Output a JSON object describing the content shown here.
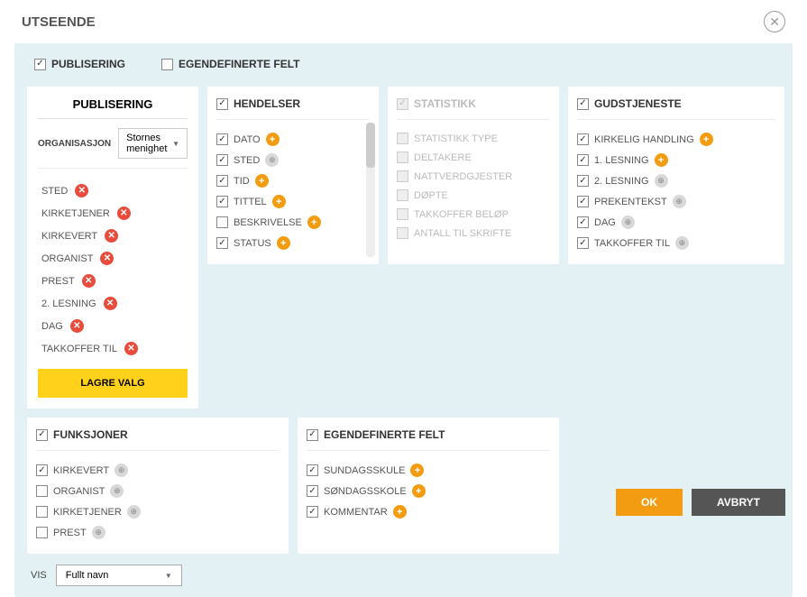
{
  "title": "UTSEENDE",
  "top": {
    "publisering": "PUBLISERING",
    "egendef": "EGENDEFINERTE FELT"
  },
  "hendelser": {
    "title": "HENDELSER",
    "items": [
      {
        "label": "DATO",
        "checked": true,
        "icon": "plus"
      },
      {
        "label": "STED",
        "checked": true,
        "icon": "globe"
      },
      {
        "label": "TID",
        "checked": true,
        "icon": "plus"
      },
      {
        "label": "TITTEL",
        "checked": true,
        "icon": "plus"
      },
      {
        "label": "BESKRIVELSE",
        "checked": false,
        "icon": "plus"
      },
      {
        "label": "STATUS",
        "checked": true,
        "icon": "plus"
      }
    ]
  },
  "statistikk": {
    "title": "STATISTIKK",
    "items": [
      {
        "label": "STATISTIKK TYPE"
      },
      {
        "label": "DELTAKERE"
      },
      {
        "label": "NATTVERDGJESTER"
      },
      {
        "label": "DØPTE"
      },
      {
        "label": "TAKKOFFER BELØP"
      },
      {
        "label": "ANTALL TIL SKRIFTE"
      }
    ]
  },
  "gudstjeneste": {
    "title": "GUDSTJENESTE",
    "items": [
      {
        "label": "KIRKELIG HANDLING",
        "checked": true,
        "icon": "plus"
      },
      {
        "label": "1. LESNING",
        "checked": true,
        "icon": "plus"
      },
      {
        "label": "2. LESNING",
        "checked": true,
        "icon": "globe"
      },
      {
        "label": "PREKENTEKST",
        "checked": true,
        "icon": "globe"
      },
      {
        "label": "DAG",
        "checked": true,
        "icon": "globe"
      },
      {
        "label": "TAKKOFFER TIL",
        "checked": true,
        "icon": "globe"
      }
    ]
  },
  "funksjoner": {
    "title": "FUNKSJONER",
    "items": [
      {
        "label": "KIRKEVERT",
        "checked": true,
        "icon": "globe"
      },
      {
        "label": "ORGANIST",
        "checked": false,
        "icon": "globe"
      },
      {
        "label": "KIRKETJENER",
        "checked": false,
        "icon": "globe"
      },
      {
        "label": "PREST",
        "checked": false,
        "icon": "globe"
      }
    ]
  },
  "egendef_felt": {
    "title": "EGENDEFINERTE FELT",
    "items": [
      {
        "label": "SUNDAGSSKULE",
        "checked": true,
        "icon": "plus"
      },
      {
        "label": "SØNDAGSSKOLE",
        "checked": true,
        "icon": "plus"
      },
      {
        "label": "KOMMENTAR",
        "checked": true,
        "icon": "plus"
      }
    ]
  },
  "publisering": {
    "title": "PUBLISERING",
    "org_label": "ORGANISASJON",
    "org_value": "Stornes menighet",
    "items": [
      "STED",
      "KIRKETJENER",
      "KIRKEVERT",
      "ORGANIST",
      "PREST",
      "2. LESNING",
      "DAG",
      "TAKKOFFER TIL"
    ],
    "save": "LAGRE VALG"
  },
  "vis": {
    "label": "VIS",
    "value": "Fullt navn"
  },
  "buttons": {
    "ok": "OK",
    "cancel": "AVBRYT"
  }
}
